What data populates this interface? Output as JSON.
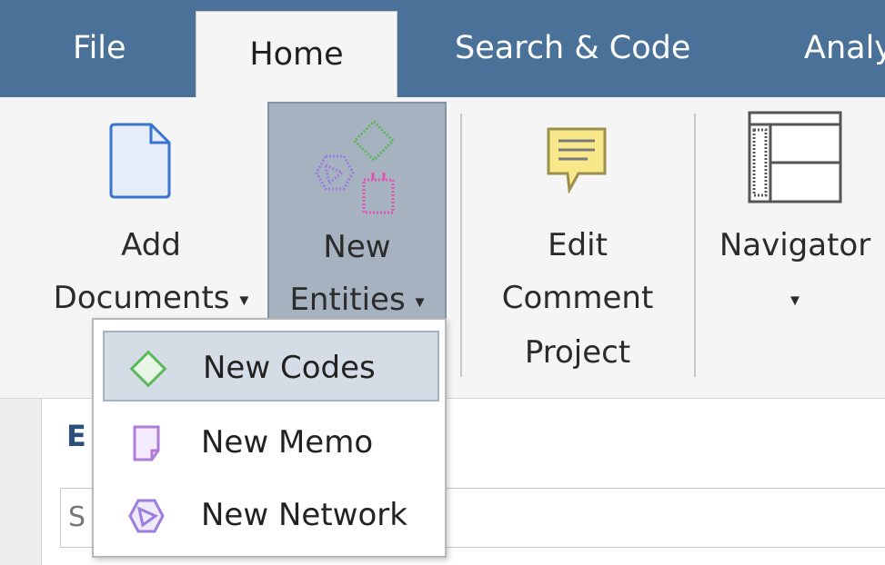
{
  "tabs": [
    "File",
    "Home",
    "Search & Code",
    "Analy"
  ],
  "ribbon": {
    "add_documents": {
      "line1": "Add",
      "line2": "Documents",
      "caret": "▾"
    },
    "new_entities": {
      "line1": "New",
      "line2": "Entities",
      "caret": "▾"
    },
    "edit_comment": {
      "line1": "Edit",
      "line2": "Comment",
      "line3": "Project"
    },
    "navigator": {
      "line1": "Navigator",
      "caret": "▾"
    }
  },
  "pane": {
    "title": "E",
    "search_text": "S"
  },
  "menu": {
    "items": [
      {
        "label": "New Codes",
        "icon": "code-diamond-icon",
        "highlighted": true
      },
      {
        "label": "New Memo",
        "icon": "memo-icon",
        "highlighted": false
      },
      {
        "label": "New Network",
        "icon": "network-icon",
        "highlighted": false
      }
    ]
  },
  "colors": {
    "tab_bar": "#4a7198",
    "ribbon_bg": "#f5f5f5",
    "selected_button": "#a6b2bf",
    "menu_highlight": "#d4dde6",
    "code_green": "#5cb85c",
    "memo_purple": "#b07cd8",
    "network_purple": "#9b7ee0",
    "entity_pink": "#e056b5"
  }
}
